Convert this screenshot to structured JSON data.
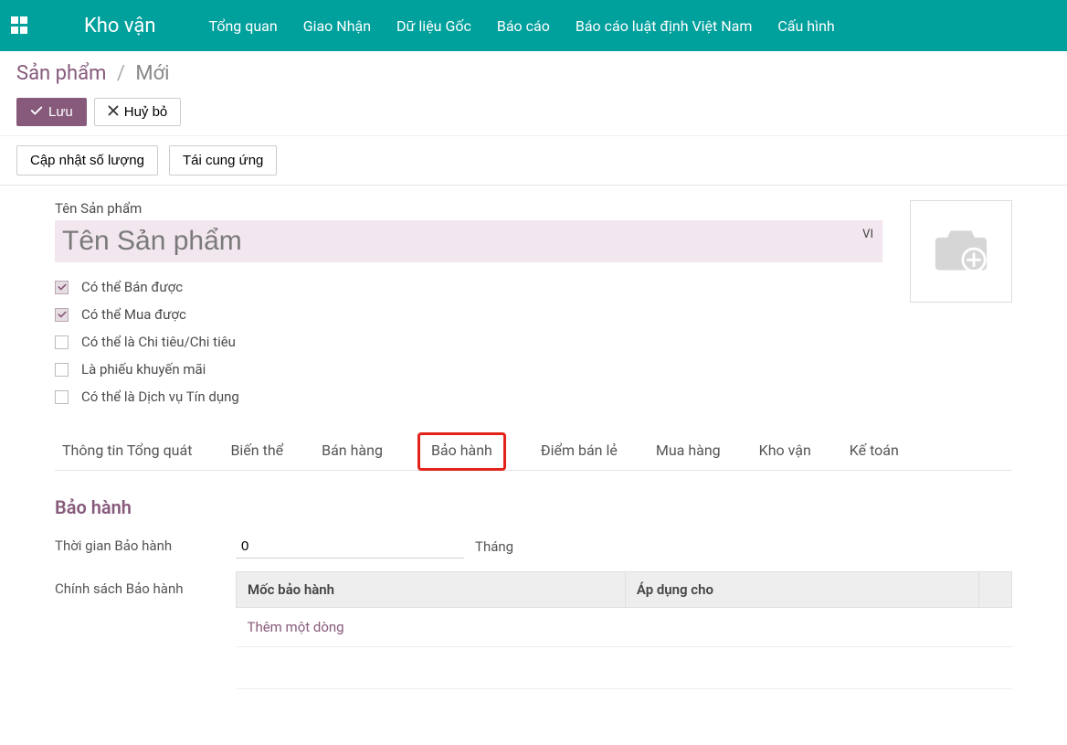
{
  "nav": {
    "brand": "Kho vận",
    "items": [
      "Tổng quan",
      "Giao Nhận",
      "Dữ liệu Gốc",
      "Báo cáo",
      "Báo cáo luật định Việt Nam",
      "Cấu hình"
    ]
  },
  "breadcrumb": {
    "root": "Sản phẩm",
    "sep": "/",
    "current": "Mới"
  },
  "buttons": {
    "save": "Lưu",
    "discard": "Huỷ bỏ",
    "update_qty": "Cập nhật số lượng",
    "replenish": "Tái cung ứng"
  },
  "form": {
    "name_label": "Tên Sản phẩm",
    "name_placeholder": "Tên Sản phẩm",
    "name_value": "",
    "lang_badge": "VI",
    "checks": [
      {
        "label": "Có thể Bán được",
        "checked": true
      },
      {
        "label": "Có thể Mua được",
        "checked": true
      },
      {
        "label": "Có thể là Chi tiêu/Chi tiêu",
        "checked": false
      },
      {
        "label": "Là phiếu khuyến mãi",
        "checked": false
      },
      {
        "label": "Có thể là Dịch vụ Tín dụng",
        "checked": false
      }
    ]
  },
  "tabs": {
    "items": [
      "Thông tin Tổng quát",
      "Biến thể",
      "Bán hàng",
      "Bảo hành",
      "Điểm bán lẻ",
      "Mua hàng",
      "Kho vận",
      "Kế toán"
    ],
    "highlighted_index": 3
  },
  "warranty": {
    "section_title": "Bảo hành",
    "period_label": "Thời gian Bảo hành",
    "period_value": "0",
    "period_unit": "Tháng",
    "policy_label": "Chính sách Bảo hành",
    "table": {
      "col_milestone": "Mốc bảo hành",
      "col_apply": "Áp dụng cho",
      "add_line": "Thêm một dòng"
    }
  }
}
